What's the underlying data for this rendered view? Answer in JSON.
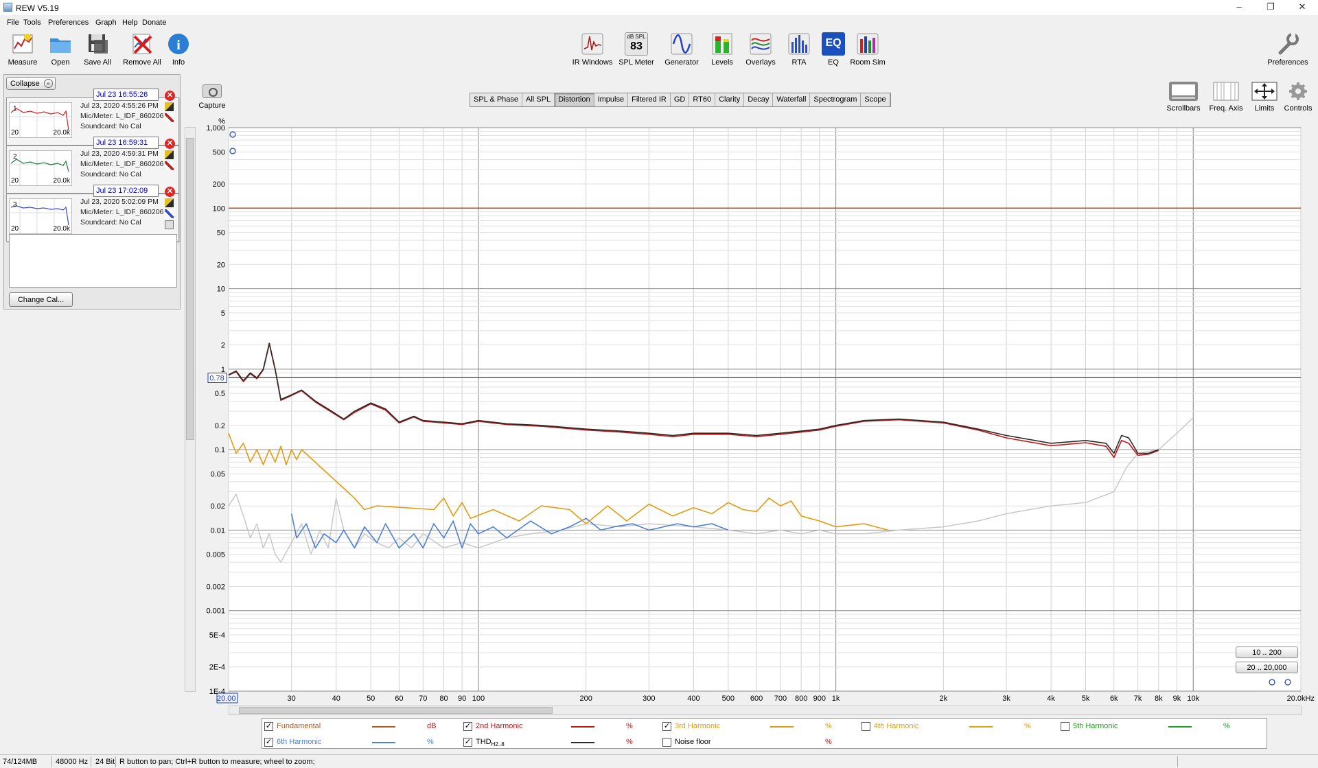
{
  "app": {
    "title": "REW V5.19"
  },
  "menu": [
    "File",
    "Tools",
    "Preferences",
    "Graph",
    "Help",
    "Donate"
  ],
  "toolbar_left": [
    "Measure",
    "Open",
    "Save All",
    "Remove All",
    "Info"
  ],
  "toolbar_center": {
    "items": [
      "IR Windows",
      "SPL Meter",
      "Generator",
      "Levels",
      "Overlays",
      "RTA",
      "EQ",
      "Room Sim"
    ],
    "spl_meter_unit": "dB SPL",
    "spl_meter_value": "83",
    "eq_icon_text": "EQ"
  },
  "toolbar_right": {
    "preferences": "Preferences"
  },
  "left_panel": {
    "collapse": "Collapse",
    "change_cal": "Change Cal...",
    "measurements": [
      {
        "index": "1",
        "name": "Jul 23 16:55:26",
        "date": "Jul 23, 2020 4:55:26 PM",
        "mic": "Mic/Meter: L_IDF_860206",
        "soundcard": "Soundcard: No Cal",
        "thumb_left": "20",
        "thumb_right": "20.0k",
        "color": "#d62020"
      },
      {
        "index": "2",
        "name": "Jul 23 16:59:31",
        "date": "Jul 23, 2020 4:59:31 PM",
        "mic": "Mic/Meter: L_IDF_860206",
        "soundcard": "Soundcard: No Cal",
        "thumb_left": "20",
        "thumb_right": "20.0k",
        "color": "#1e7a3a"
      },
      {
        "index": "3",
        "name": "Jul 23 17:02:09",
        "date": "Jul 23, 2020 5:02:09 PM",
        "mic": "Mic/Meter: L_IDF_860206",
        "soundcard": "Soundcard: No Cal",
        "thumb_left": "20",
        "thumb_right": "20.0k",
        "color": "#3a4bd0"
      }
    ]
  },
  "capture": "Capture",
  "graph_tabs": [
    "SPL & Phase",
    "All SPL",
    "Distortion",
    "Impulse",
    "Filtered IR",
    "GD",
    "RT60",
    "Clarity",
    "Decay",
    "Waterfall",
    "Spectrogram",
    "Scope"
  ],
  "active_tab": "Distortion",
  "right_tools": [
    "Scrollbars",
    "Freq. Axis",
    "Limits",
    "Controls"
  ],
  "range_buttons": [
    "10 .. 200",
    "20 .. 20,000"
  ],
  "chart_data": {
    "type": "line",
    "ylabel": "%",
    "yscale": "log",
    "ylim": [
      0.0001,
      1000
    ],
    "y_ticks": [
      "1,000",
      "500",
      "200",
      "100",
      "50",
      "20",
      "10",
      "5",
      "2",
      "1",
      "0.5",
      "0.2",
      "0.1",
      "0.05",
      "0.02",
      "0.01",
      "0.005",
      "0.002",
      "0.001",
      "5E-4",
      "2E-4",
      "1E-4"
    ],
    "y_tick_values": [
      1000,
      500,
      200,
      100,
      50,
      20,
      10,
      5,
      2,
      1,
      0.5,
      0.2,
      0.1,
      0.05,
      0.02,
      0.01,
      0.005,
      0.002,
      0.001,
      0.0005,
      0.0002,
      0.0001
    ],
    "xscale": "log",
    "xlim": [
      20,
      20000
    ],
    "x_ticks": [
      "20.00",
      "30",
      "40",
      "50",
      "60",
      "70",
      "80",
      "90",
      "100",
      "200",
      "300",
      "400",
      "500",
      "600",
      "700",
      "800",
      "900",
      "1k",
      "2k",
      "3k",
      "4k",
      "5k",
      "6k",
      "7k",
      "8k",
      "9k",
      "10k",
      "20.0kHz"
    ],
    "x_tick_values": [
      20,
      30,
      40,
      50,
      60,
      70,
      80,
      90,
      100,
      200,
      300,
      400,
      500,
      600,
      700,
      800,
      900,
      1000,
      2000,
      3000,
      4000,
      5000,
      6000,
      7000,
      8000,
      9000,
      10000,
      20000
    ],
    "cursor_value": "0.78",
    "cursor_y": 0.78,
    "grid": true,
    "series": [
      {
        "name": "Fundamental",
        "unit": "dB",
        "color": "#b05a1e",
        "visible": true,
        "x": [
          20,
          20000
        ],
        "y": [
          100,
          100
        ]
      },
      {
        "name": "THD H2..8",
        "unit": "%",
        "color": "#2a2a2a",
        "visible": true,
        "x": [
          20,
          21,
          22,
          23,
          24,
          25,
          26,
          27,
          28,
          30,
          32,
          35,
          38,
          42,
          45,
          50,
          55,
          60,
          66,
          70,
          80,
          90,
          100,
          120,
          150,
          200,
          250,
          300,
          350,
          400,
          500,
          600,
          700,
          800,
          900,
          1000,
          1200,
          1500,
          2000,
          2500,
          3000,
          4000,
          5000,
          5700,
          6000,
          6300,
          6600,
          7000,
          7500,
          8000
        ],
        "y": [
          0.85,
          0.95,
          0.72,
          0.9,
          0.78,
          1.0,
          2.1,
          1.0,
          0.42,
          0.48,
          0.55,
          0.4,
          0.32,
          0.24,
          0.3,
          0.38,
          0.32,
          0.22,
          0.26,
          0.23,
          0.22,
          0.21,
          0.23,
          0.21,
          0.2,
          0.18,
          0.17,
          0.16,
          0.15,
          0.16,
          0.16,
          0.15,
          0.16,
          0.17,
          0.18,
          0.2,
          0.23,
          0.24,
          0.22,
          0.18,
          0.15,
          0.12,
          0.13,
          0.12,
          0.09,
          0.15,
          0.14,
          0.09,
          0.09,
          0.1
        ]
      },
      {
        "name": "2nd Harmonic",
        "unit": "%",
        "color": "#c21414",
        "visible": true,
        "x": [
          20,
          21,
          22,
          23,
          24,
          25,
          26,
          27,
          28,
          30,
          32,
          35,
          38,
          42,
          45,
          50,
          55,
          60,
          66,
          70,
          80,
          90,
          100,
          120,
          150,
          200,
          250,
          300,
          350,
          400,
          500,
          600,
          700,
          800,
          900,
          1000,
          1200,
          1500,
          2000,
          2500,
          3000,
          4000,
          5000,
          5700,
          6000,
          6300,
          6600,
          7000,
          7500,
          8000
        ],
        "y": [
          0.84,
          0.93,
          0.7,
          0.88,
          0.76,
          0.98,
          2.05,
          0.98,
          0.41,
          0.47,
          0.54,
          0.39,
          0.31,
          0.235,
          0.29,
          0.37,
          0.31,
          0.215,
          0.255,
          0.225,
          0.215,
          0.205,
          0.225,
          0.205,
          0.195,
          0.175,
          0.165,
          0.155,
          0.145,
          0.155,
          0.155,
          0.145,
          0.155,
          0.165,
          0.175,
          0.195,
          0.225,
          0.235,
          0.215,
          0.175,
          0.14,
          0.112,
          0.122,
          0.11,
          0.08,
          0.13,
          0.12,
          0.085,
          0.088,
          0.098
        ]
      },
      {
        "name": "3rd Harmonic",
        "unit": "%",
        "color": "#e39a10",
        "visible": true,
        "x": [
          20,
          21,
          22,
          23,
          24,
          25,
          26,
          27,
          28,
          29,
          30,
          31,
          32,
          45,
          48,
          52,
          75,
          80,
          85,
          90,
          95,
          110,
          130,
          150,
          180,
          200,
          230,
          260,
          300,
          350,
          400,
          450,
          500,
          550,
          600,
          650,
          700,
          750,
          800,
          900,
          1000,
          1200,
          1400
        ],
        "y": [
          0.16,
          0.09,
          0.12,
          0.07,
          0.1,
          0.065,
          0.1,
          0.07,
          0.11,
          0.065,
          0.1,
          0.075,
          0.1,
          0.025,
          0.018,
          0.02,
          0.018,
          0.025,
          0.015,
          0.022,
          0.014,
          0.018,
          0.013,
          0.02,
          0.018,
          0.012,
          0.02,
          0.013,
          0.021,
          0.015,
          0.019,
          0.016,
          0.022,
          0.018,
          0.017,
          0.025,
          0.02,
          0.023,
          0.015,
          0.013,
          0.011,
          0.012,
          0.01
        ]
      },
      {
        "name": "4th Harmonic",
        "unit": "%",
        "color": "#e3a010",
        "visible": false,
        "x": [],
        "y": []
      },
      {
        "name": "5th Harmonic",
        "unit": "%",
        "color": "#1ea01e",
        "visible": false,
        "x": [],
        "y": []
      },
      {
        "name": "6th Harmonic",
        "unit": "%",
        "color": "#4a80d8",
        "visible": true,
        "x": [
          30,
          31,
          33,
          35,
          37,
          40,
          42,
          45,
          48,
          52,
          55,
          60,
          66,
          70,
          75,
          80,
          85,
          90,
          95,
          100,
          110,
          120,
          140,
          160,
          180,
          200,
          220,
          240,
          270,
          300,
          330,
          360,
          400,
          450,
          500
        ],
        "y": [
          0.016,
          0.008,
          0.012,
          0.006,
          0.009,
          0.007,
          0.01,
          0.006,
          0.011,
          0.007,
          0.012,
          0.006,
          0.009,
          0.006,
          0.012,
          0.008,
          0.013,
          0.006,
          0.012,
          0.009,
          0.011,
          0.008,
          0.013,
          0.009,
          0.011,
          0.014,
          0.01,
          0.011,
          0.012,
          0.01,
          0.011,
          0.012,
          0.011,
          0.012,
          0.01
        ]
      },
      {
        "name": "Noise floor",
        "unit": "%",
        "color": "#c8c8c8",
        "visible": false,
        "x": [
          20,
          21,
          22,
          23,
          24,
          25,
          26,
          27,
          28,
          30,
          32,
          34,
          36,
          38,
          40,
          42,
          45,
          48,
          52,
          56,
          60,
          65,
          70,
          80,
          90,
          100,
          120,
          140,
          170,
          200,
          250,
          300,
          400,
          500,
          600,
          700,
          800,
          900,
          1000,
          1200,
          1500,
          2000,
          2500,
          3000,
          4000,
          5000,
          6000,
          6500,
          7000,
          8000,
          9000,
          10000
        ],
        "y": [
          0.02,
          0.028,
          0.015,
          0.008,
          0.012,
          0.006,
          0.009,
          0.005,
          0.004,
          0.007,
          0.012,
          0.005,
          0.01,
          0.006,
          0.025,
          0.01,
          0.006,
          0.009,
          0.007,
          0.006,
          0.008,
          0.006,
          0.009,
          0.006,
          0.007,
          0.006,
          0.008,
          0.009,
          0.01,
          0.012,
          0.011,
          0.012,
          0.011,
          0.01,
          0.009,
          0.01,
          0.009,
          0.01,
          0.009,
          0.009,
          0.01,
          0.011,
          0.013,
          0.016,
          0.02,
          0.022,
          0.03,
          0.06,
          0.09,
          0.1,
          0.16,
          0.25
        ]
      }
    ]
  },
  "legend": [
    {
      "name": "Fundamental",
      "unit": "dB",
      "checked": true,
      "color": "#b05a1e"
    },
    {
      "name": "2nd Harmonic",
      "unit": "%",
      "checked": true,
      "color": "#c21414"
    },
    {
      "name": "3rd Harmonic",
      "unit": "%",
      "checked": true,
      "color": "#e39a10"
    },
    {
      "name": "4th Harmonic",
      "unit": "%",
      "checked": false,
      "color": "#e3a010"
    },
    {
      "name": "5th Harmonic",
      "unit": "%",
      "checked": false,
      "color": "#1ea01e"
    },
    {
      "name": "6th Harmonic",
      "unit": "%",
      "checked": true,
      "color": "#4a80d8"
    },
    {
      "name": "THD",
      "sub": "H2..8",
      "unit": "%",
      "checked": true,
      "color": "#2a2a2a"
    },
    {
      "name": "Noise floor",
      "unit": "%",
      "checked": false,
      "color": "#c8c8c8"
    }
  ],
  "status": {
    "memory": "74/124MB",
    "sample_rate": "48000 Hz",
    "bit_depth": "24 Bit",
    "hint": "R button to pan; Ctrl+R button to measure; wheel to zoom;"
  }
}
